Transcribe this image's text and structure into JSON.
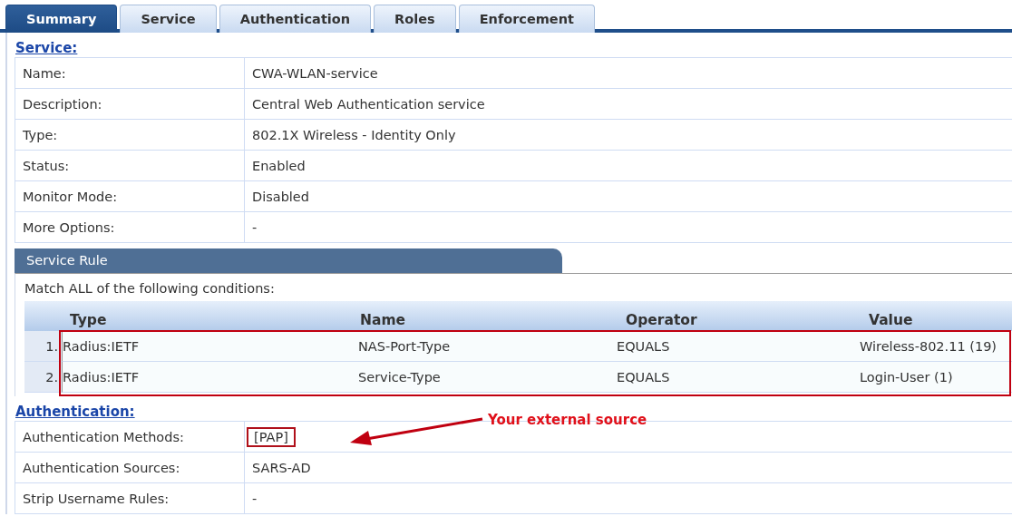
{
  "tabs": [
    {
      "label": "Summary",
      "selected": true
    },
    {
      "label": "Service",
      "selected": false
    },
    {
      "label": "Authentication",
      "selected": false
    },
    {
      "label": "Roles",
      "selected": false
    },
    {
      "label": "Enforcement",
      "selected": false
    }
  ],
  "service": {
    "heading": "Service:",
    "rows": [
      {
        "label": "Name:",
        "value": "CWA-WLAN-service"
      },
      {
        "label": "Description:",
        "value": "Central Web Authentication service"
      },
      {
        "label": "Type:",
        "value": "802.1X Wireless - Identity Only"
      },
      {
        "label": "Status:",
        "value": "Enabled"
      },
      {
        "label": "Monitor Mode:",
        "value": "Disabled"
      },
      {
        "label": "More Options:",
        "value": "-"
      }
    ]
  },
  "service_rule": {
    "title": "Service Rule",
    "match_text": "Match ALL of the following conditions:",
    "columns": [
      "Type",
      "Name",
      "Operator",
      "Value"
    ],
    "highlighted": true,
    "rows": [
      {
        "index": "1.",
        "type": "Radius:IETF",
        "name": "NAS-Port-Type",
        "operator": "EQUALS",
        "value": "Wireless-802.11 (19)"
      },
      {
        "index": "2.",
        "type": "Radius:IETF",
        "name": "Service-Type",
        "operator": "EQUALS",
        "value": "Login-User (1)"
      }
    ]
  },
  "authentication": {
    "heading": "Authentication:",
    "rows": [
      {
        "label": "Authentication Methods:",
        "value": "[PAP]",
        "highlighted": true
      },
      {
        "label": "Authentication Sources:",
        "value": "SARS-AD",
        "highlighted": false
      },
      {
        "label": "Strip Username Rules:",
        "value": "-",
        "highlighted": false
      }
    ]
  },
  "annotation": {
    "text": "Your external source"
  }
}
